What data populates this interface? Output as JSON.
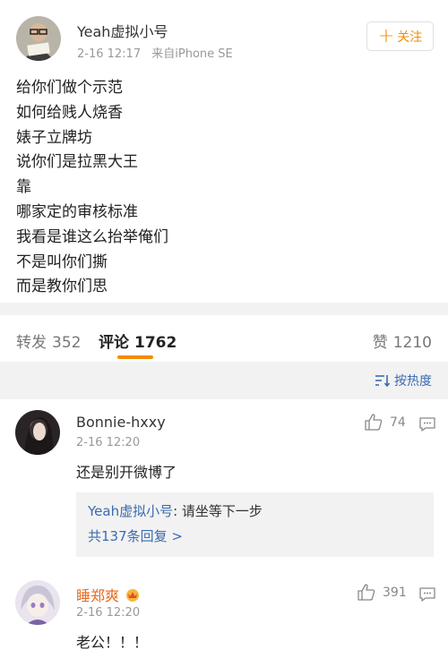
{
  "post": {
    "author": "Yeah虚拟小号",
    "date": "2-16 12:17",
    "source": "来自iPhone SE",
    "follow_label": "关注",
    "lines": [
      "给你们做个示范",
      "如何给贱人烧香",
      "婊子立牌坊",
      "说你们是拉黑大王",
      "靠",
      "哪家定的审核标准",
      "我看是谁这么抬举俺们",
      "不是叫你们撕",
      "而是教你们思"
    ]
  },
  "stats": {
    "repost_label": "转发",
    "repost_count": "352",
    "comment_label": "评论",
    "comment_count": "1762",
    "like_label": "赞",
    "like_count": "1210"
  },
  "sort": {
    "label": "按热度"
  },
  "comments": [
    {
      "name": "Bonnie-hxxy",
      "time": "2-16 12:20",
      "likes": "74",
      "text": "还是别开微博了",
      "reply_user": "Yeah虚拟小号",
      "reply_text": ": 请坐等下一步",
      "reply_more": "共137条回复 >"
    },
    {
      "name": "睡郑爽",
      "time": "2-16 12:20",
      "likes": "391",
      "text": "老公！！！"
    }
  ],
  "colors": {
    "accent": "#f28d00",
    "link": "#3a6bb0",
    "vip_name": "#e86a1f"
  }
}
